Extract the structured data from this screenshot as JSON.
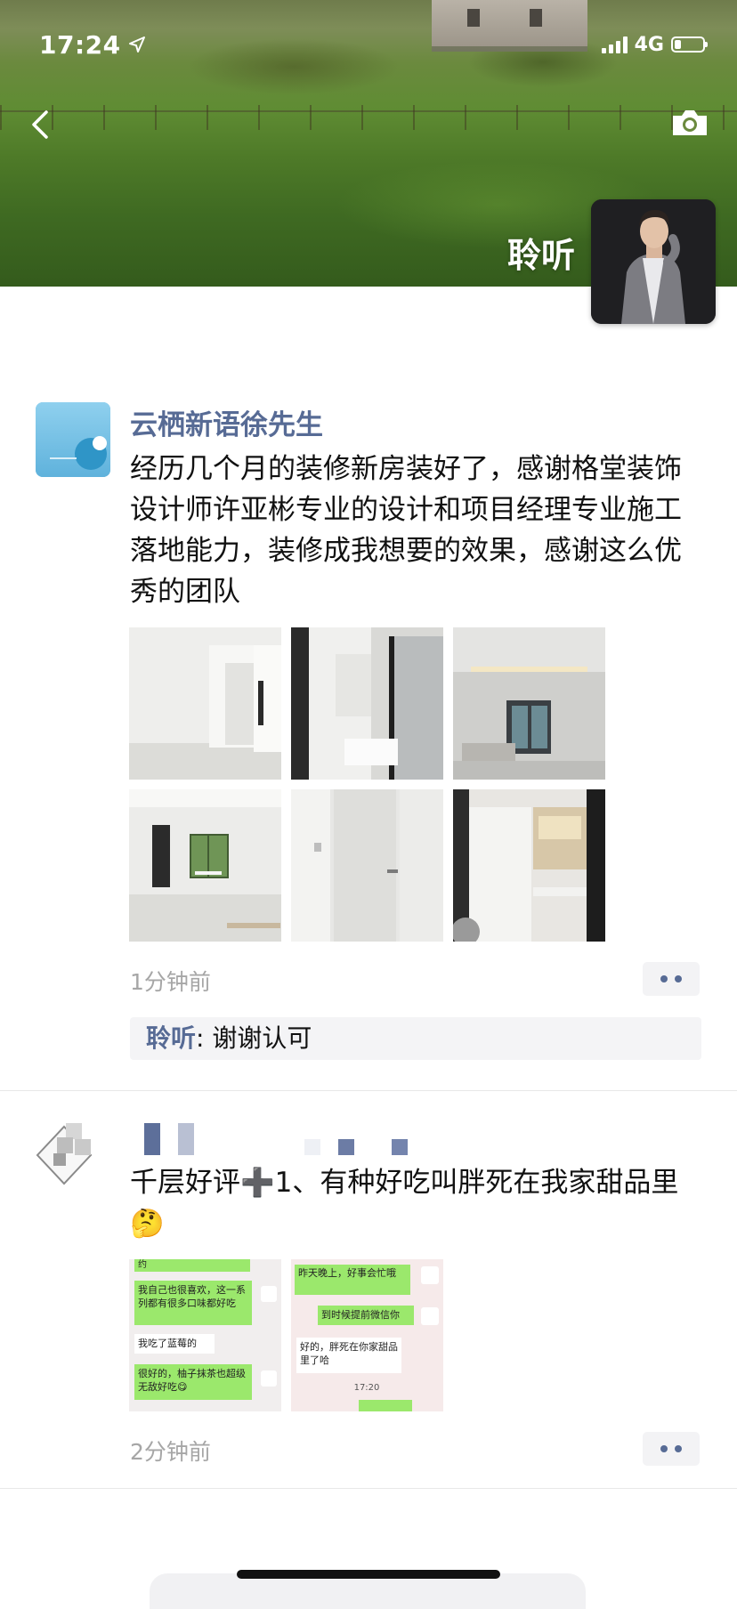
{
  "status_bar": {
    "time": "17:24",
    "network": "4G"
  },
  "profile": {
    "name": "聆听"
  },
  "icons": {
    "back": "chevron-left-icon",
    "camera": "camera-icon",
    "location": "location-arrow-icon",
    "more": "more-dots-icon"
  },
  "posts": [
    {
      "author": "云栖新语徐先生",
      "text": "经历几个月的装修新房装好了，感谢格堂装饰设计师许亚彬专业的设计和项目经理专业施工落地能力，装修成我想要的效果，感谢这么优秀的团队",
      "time": "1分钟前",
      "comments": [
        {
          "author": "聆听",
          "separator": ": ",
          "text": "谢谢认可"
        }
      ]
    },
    {
      "author": "",
      "text": "千层好评➕1、有种好吃叫胖死在我家甜品里🤔",
      "time": "2分钟前",
      "chat_screenshot_1": {
        "lines": [
          "约",
          "我自己也很喜欢，这一系列都有很多口味都好吃",
          "我吃了蓝莓的",
          "很好的，柚子抹茶也超级无敌好吃😋"
        ]
      },
      "chat_screenshot_2": {
        "lines": [
          "昨天晚上，好事会忙哦",
          "到时候提前微信你",
          "好的，胖死在你家甜品里了哈",
          "17:20"
        ]
      }
    }
  ],
  "colors": {
    "link": "#576b95",
    "time_gray": "#a6a6a6",
    "comment_bg": "#f4f4f6"
  }
}
